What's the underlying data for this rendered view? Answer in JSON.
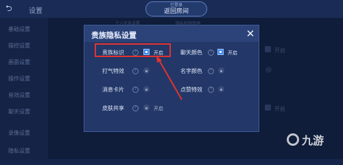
{
  "background": {
    "header_title": "设置",
    "room_button": {
      "sub": "已登录",
      "label": "返回房间"
    },
    "sidebar_items": [
      "基础设置",
      "操控设置",
      "画面设置",
      "操作设置",
      "音效设置",
      "聊天设置",
      "录像设置",
      "隐私设置"
    ],
    "tabs": [
      "个人信息设置",
      "隐私权限管理"
    ],
    "right_texts": [
      "开启",
      "开启"
    ]
  },
  "dialog": {
    "title": "贵族隐私设置",
    "close_icon": "close-icon",
    "rows": [
      {
        "label": "贵族标识",
        "state": "开启",
        "control": "toggle-on"
      },
      {
        "label": "聊天颜色",
        "state": "开启",
        "control": "toggle-on"
      },
      {
        "label": "打气特效",
        "state": "",
        "control": "lock"
      },
      {
        "label": "名字颜色",
        "state": "",
        "control": "lock"
      },
      {
        "label": "消息卡片",
        "state": "",
        "control": "lock"
      },
      {
        "label": "点赞特效",
        "state": "",
        "control": "lock"
      },
      {
        "label": "皮肤共享",
        "state": "开启",
        "control": "lock"
      }
    ]
  },
  "annotation": {
    "color": "#e5322f"
  },
  "watermark": {
    "text": "九游"
  }
}
